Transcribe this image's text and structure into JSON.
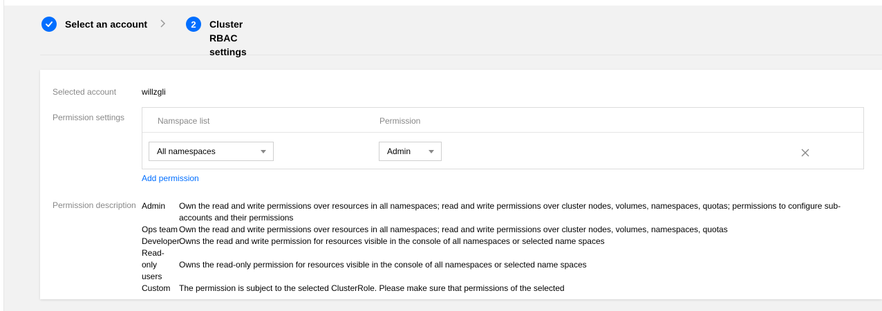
{
  "stepper": {
    "step1": {
      "label": "Select an account",
      "state": "done"
    },
    "step2": {
      "number": "2",
      "label": "Cluster RBAC settings"
    }
  },
  "form": {
    "selected_account_label": "Selected account",
    "selected_account_value": "willzgli",
    "permission_settings_label": "Permission settings",
    "table": {
      "col_namespace": "Namspace list",
      "col_permission": "Permission",
      "row": {
        "namespace": "All namespaces",
        "permission": "Admin"
      }
    },
    "add_permission": "Add permission",
    "permission_description_label": "Permission description",
    "descriptions": [
      {
        "name": "Admin",
        "text": "Own the read and write permissions over resources in all namespaces; read and write permissions over cluster nodes, volumes, namespaces, quotas; permissions to configure sub-accounts and their permissions"
      },
      {
        "name": "Ops team",
        "text": "Own the read and write permissions over resources in all namespaces; read and write permissions over cluster nodes, volumes, namespaces, quotas"
      },
      {
        "name": "Developer",
        "text": "Owns the read and write permission for resources visible in the console of all namespaces or selected name spaces"
      },
      {
        "name": "Read-only users",
        "text": "Owns the read-only permission for resources visible in the console of all namespaces or selected name spaces"
      },
      {
        "name": "Custom",
        "text": "The permission is subject to the selected ClusterRole. Please make sure that permissions of the selected"
      }
    ]
  },
  "colors": {
    "accent": "#006eff",
    "muted": "#888888"
  },
  "icons": {
    "step1": "check-icon",
    "separator": "chevron-right-icon",
    "dropdown": "caret-down-icon",
    "remove": "close-icon"
  }
}
